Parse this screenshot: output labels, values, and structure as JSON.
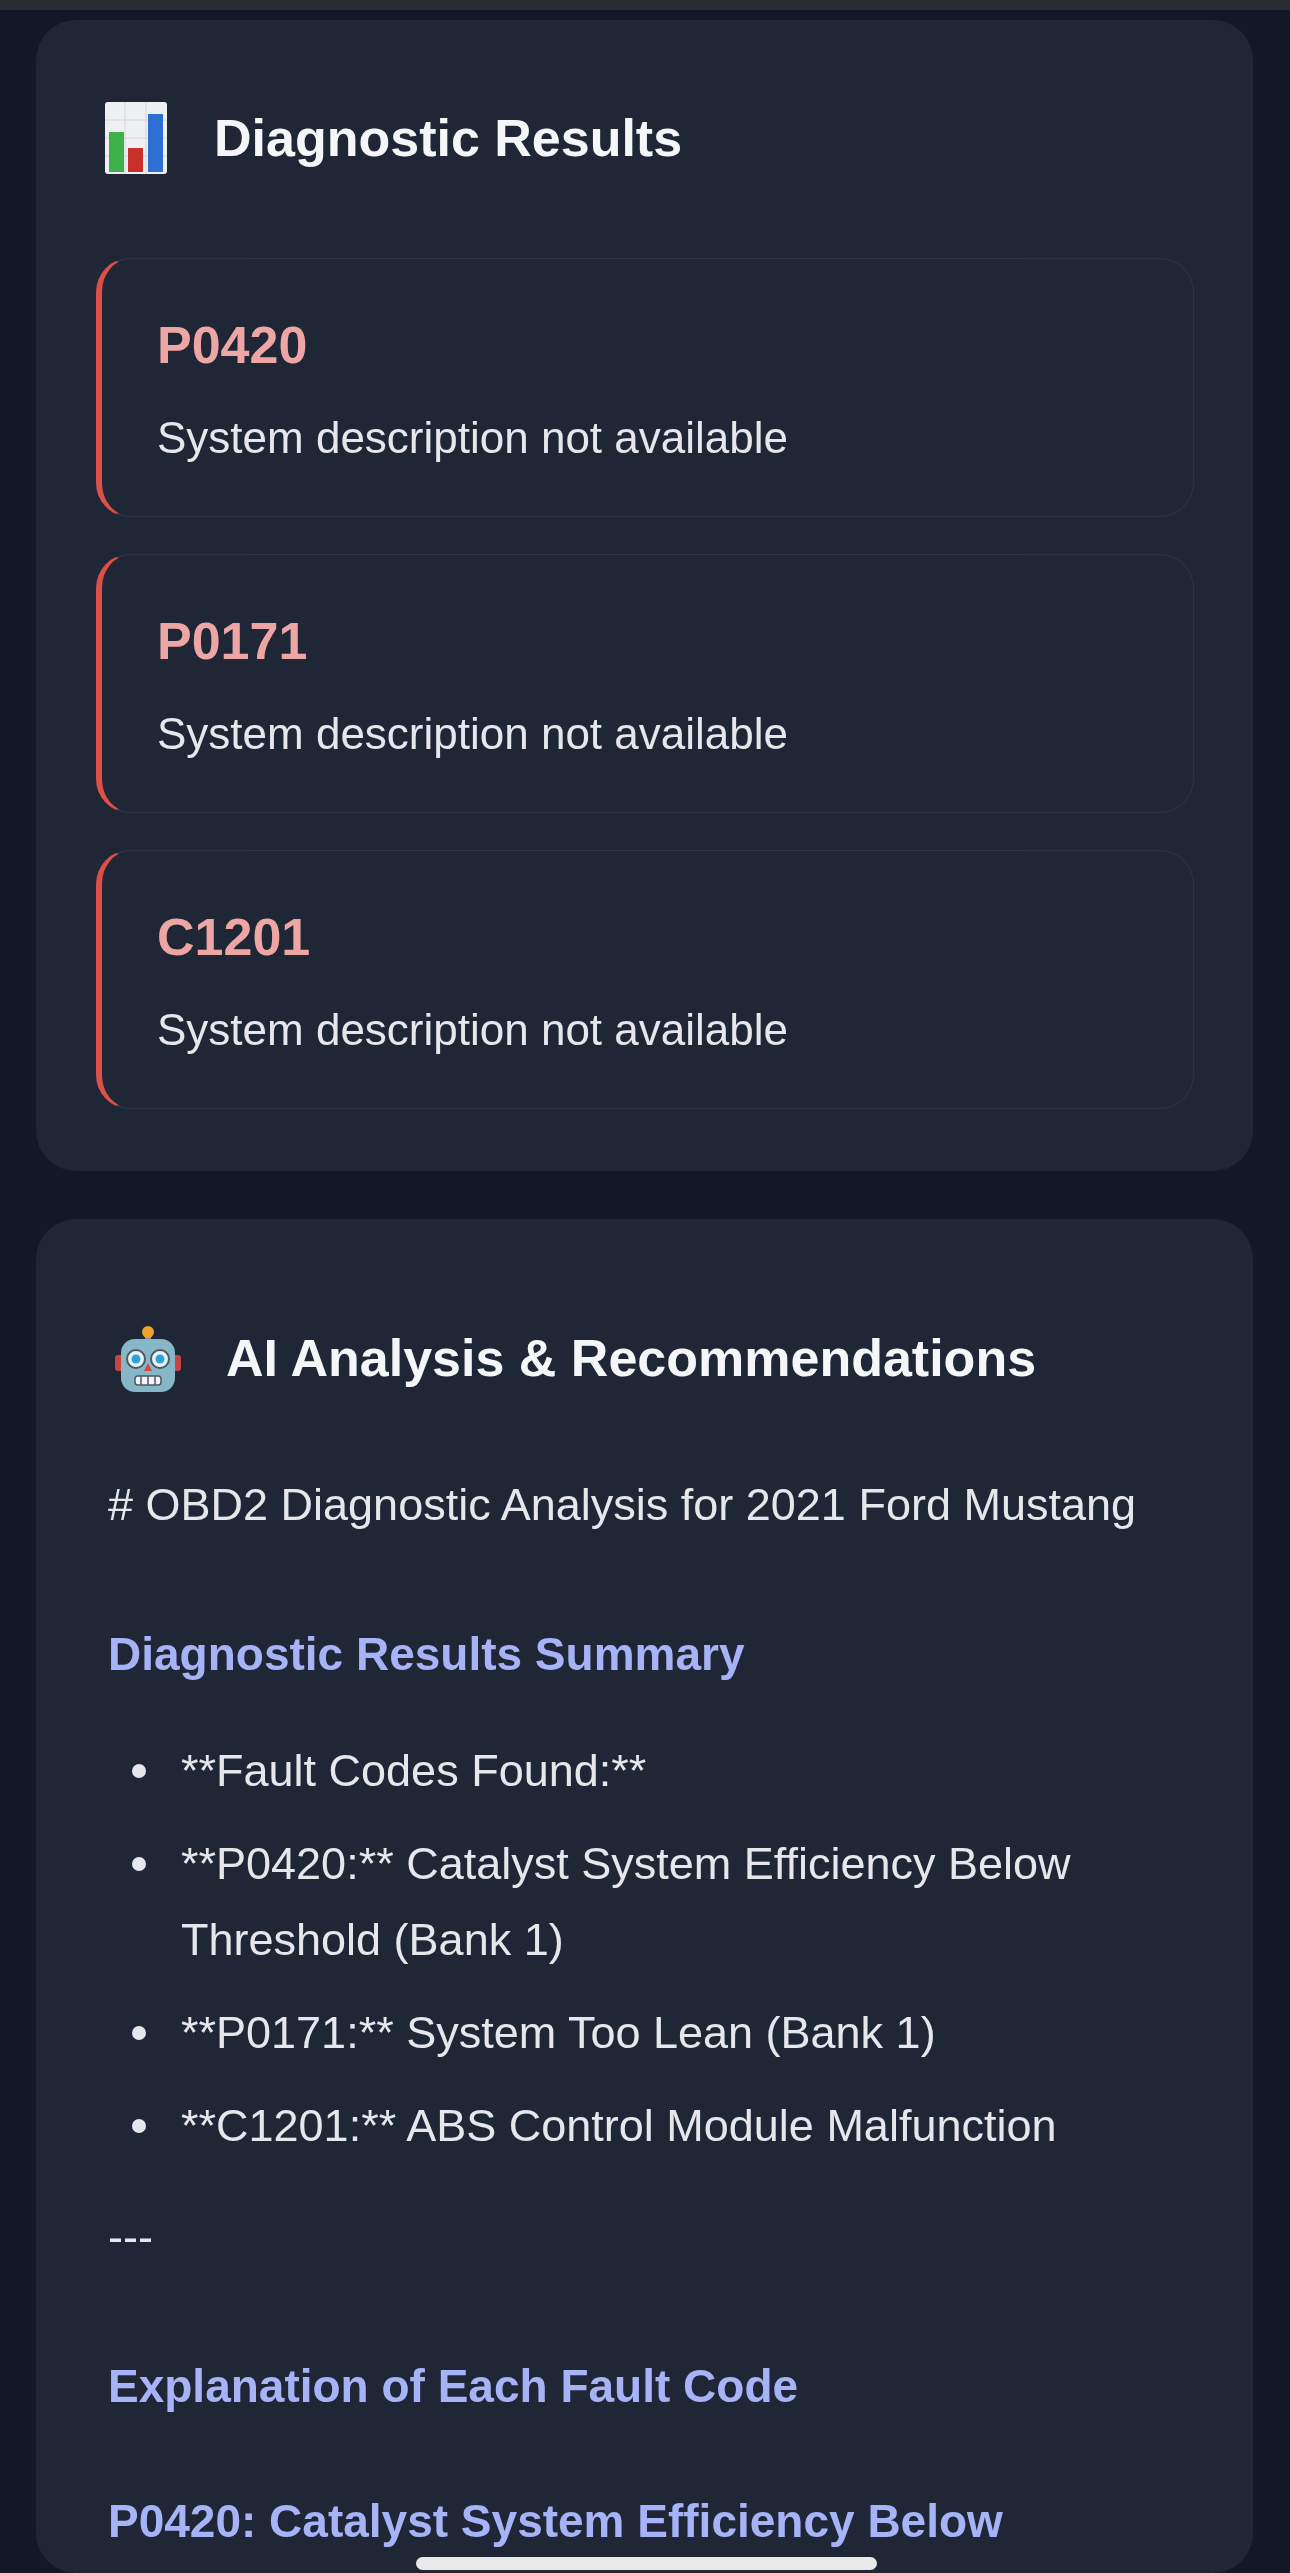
{
  "results_panel": {
    "title": "Diagnostic Results",
    "codes": [
      {
        "code": "P0420",
        "description": "System description not available"
      },
      {
        "code": "P0171",
        "description": "System description not available"
      },
      {
        "code": "C1201",
        "description": "System description not available"
      }
    ]
  },
  "analysis_panel": {
    "title": "AI Analysis & Recommendations",
    "content": [
      {
        "kind": "paragraph",
        "text": "# OBD2 Diagnostic Analysis for 2021 Ford Mustang"
      },
      {
        "kind": "heading",
        "text": "Diagnostic Results Summary"
      },
      {
        "kind": "list",
        "items": [
          "**Fault Codes Found:**",
          "**P0420:** Catalyst System Efficiency Below Threshold (Bank 1)",
          "**P0171:** System Too Lean (Bank 1)",
          "**C1201:** ABS Control Module Malfunction"
        ]
      },
      {
        "kind": "paragraph",
        "text": "---"
      },
      {
        "kind": "heading",
        "text": "Explanation of Each Fault Code"
      },
      {
        "kind": "heading",
        "text": "P0420: Catalyst System Efficiency Below"
      }
    ]
  }
}
